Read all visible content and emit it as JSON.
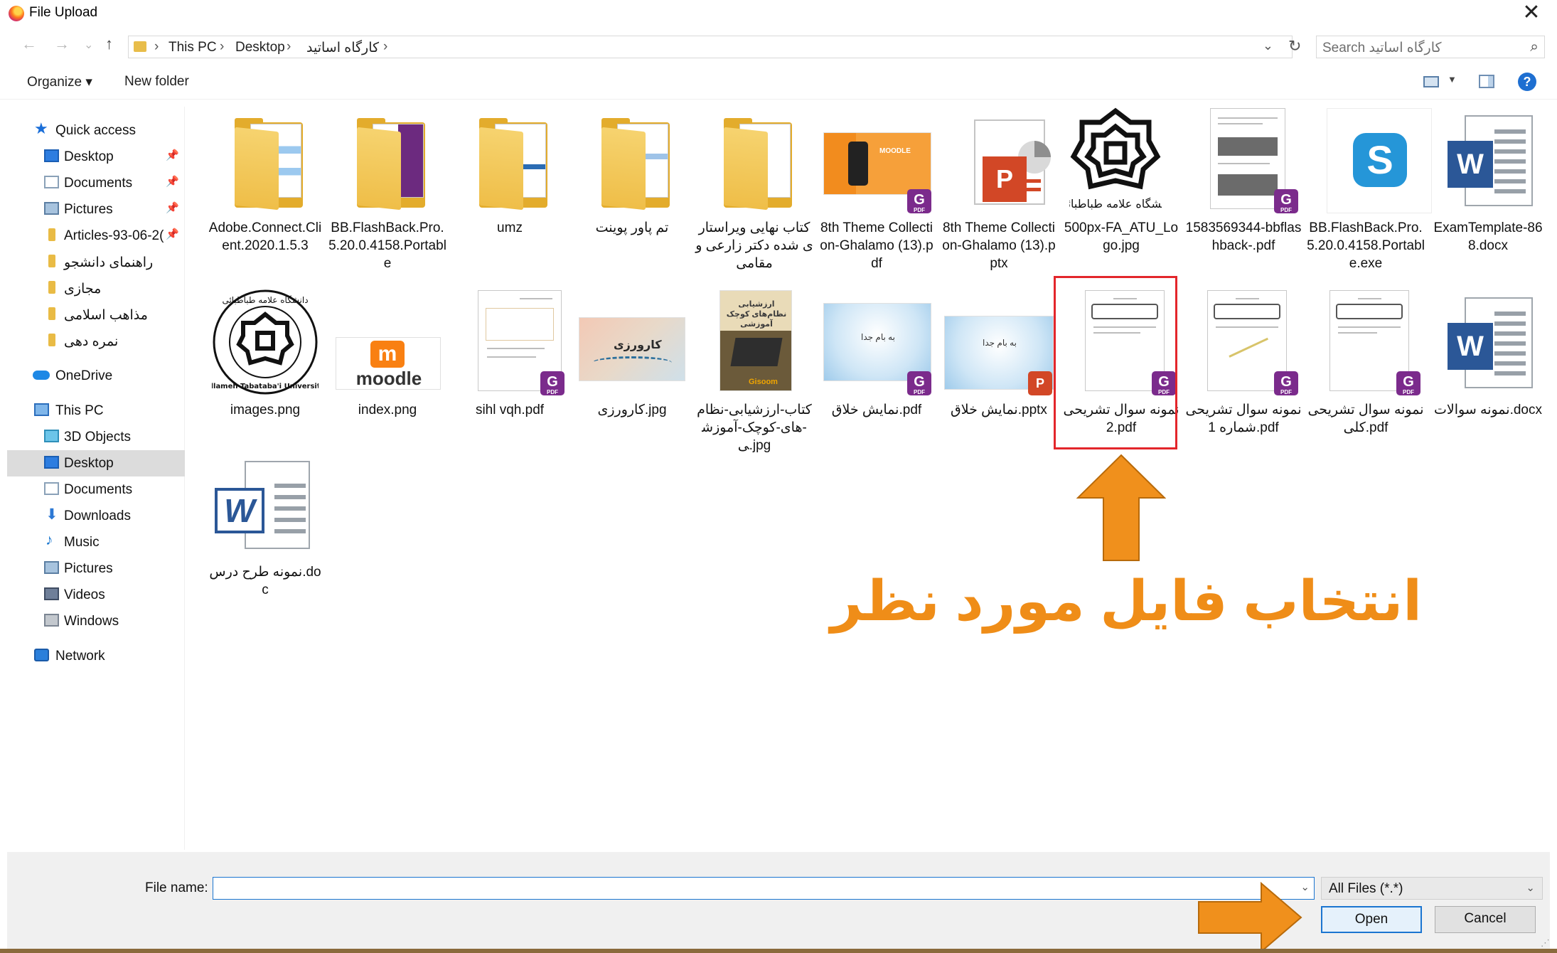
{
  "window": {
    "title": "File Upload",
    "close_glyph": "✕"
  },
  "nav": {
    "back_glyph": "←",
    "forward_glyph": "→",
    "recent_glyph": "⌄",
    "up_glyph": "↑",
    "path": [
      "This PC",
      "Desktop",
      "کارگاه اساتید"
    ],
    "refresh_glyph": "↻",
    "search_placeholder": "Search کارگاه اساتید"
  },
  "toolbar": {
    "organize": "Organize ▾",
    "new_folder": "New folder",
    "help": "?"
  },
  "sidebar": {
    "quick_access": "Quick access",
    "qa_items": [
      "Desktop",
      "Documents",
      "Pictures",
      "Articles-93-06-2(",
      "راهنمای دانشجو",
      "مجازی",
      "مذاهب اسلامی",
      "نمره دهی"
    ],
    "onedrive": "OneDrive",
    "this_pc": "This PC",
    "pc_items": [
      "3D Objects",
      "Desktop",
      "Documents",
      "Downloads",
      "Music",
      "Pictures",
      "Videos",
      "Windows"
    ],
    "network": "Network"
  },
  "files": [
    "Adobe.Connect.Client.2020.1.5.3",
    "BB.FlashBack.Pro.5.20.0.4158.Portable",
    "umz",
    "تم پاور پوینت",
    "کتاب نهایی ویراستاری شده دکتر زارعی و مقامی",
    "8th Theme Collection-Ghalamo (13).pdf",
    "8th Theme Collection-Ghalamo (13).pptx",
    "500px-FA_ATU_Logo.jpg",
    "1583569344-bbflashback-.pdf",
    "BB.FlashBack.Pro.5.20.0.4158.Portable.exe",
    "ExamTemplate-868.docx",
    "images.png",
    "index.png",
    "sihl vqh.pdf",
    "کارورزی.jpg",
    "کتاب-ارزشیابی-نظام-های-کوچک-آموزشی.jpg",
    "نمایش خلاق.pdf",
    "نمایش خلاق.pptx",
    "نمونه سوال تشریحی 2.pdf",
    "نمونه سوال تشریحی شماره 1.pdf",
    "نمونه سوال تشریحی کلی.pdf",
    "نمونه سوالات.docx",
    "نمونه طرح درس.doc"
  ],
  "thumb_text": {
    "moodle_word": "moodle",
    "moodle_m": "m",
    "karvarzi": "کارورزی",
    "namayesh": "به بام جدا",
    "moodle_ad": "MOODLE",
    "book_title": "ارزشیابی نظام‌های کوچک آموزشی",
    "gisoom": "Gisoom",
    "atu_seal": "دانشگاه علامه طباطبائی",
    "atu_seal_en": "Allameh Tabataba'i University"
  },
  "annotation": {
    "text": "انتخاب فایل مورد نظر",
    "color": "#ef8d18"
  },
  "highlight_color": "#e3262b",
  "footer": {
    "file_name_label": "File name:",
    "file_name_value": "",
    "file_type": "All Files (*.*)",
    "open": "Open",
    "cancel": "Cancel"
  }
}
